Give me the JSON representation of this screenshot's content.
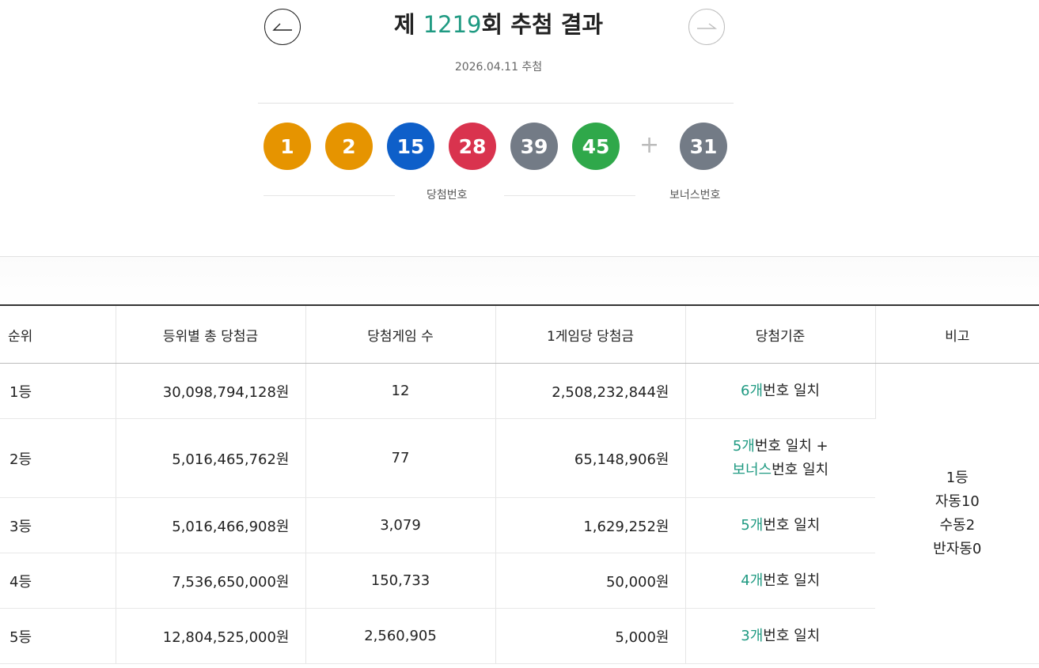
{
  "header": {
    "title_prefix": "제 ",
    "round": "1219",
    "title_suffix": "회 추첨 결과",
    "date": "2026.04.11 추첨"
  },
  "navigation": {
    "prev_icon": "arrow-left-icon",
    "next_icon": "arrow-right-icon"
  },
  "balls": [
    {
      "number": "1",
      "color": "#e69400"
    },
    {
      "number": "2",
      "color": "#e69400"
    },
    {
      "number": "15",
      "color": "#0e5fc9"
    },
    {
      "number": "28",
      "color": "#d9334e"
    },
    {
      "number": "39",
      "color": "#737b86"
    },
    {
      "number": "45",
      "color": "#2fa84a"
    }
  ],
  "plus_sign": "+",
  "bonus_ball": {
    "number": "31",
    "color": "#737b86"
  },
  "labels": {
    "winning": "당첨번호",
    "bonus": "보너스번호"
  },
  "table": {
    "headers": [
      "순위",
      "등위별 총 당첨금",
      "당첨게임 수",
      "1게임당 당첨금",
      "당첨기준",
      "비고"
    ],
    "rows": [
      {
        "rank": "1등",
        "total": "30,098,794,128원",
        "count": "12",
        "each": "2,508,232,844원",
        "crit_a_num": "6개",
        "crit_a_text": "번호 일치",
        "crit_b_num": "",
        "crit_b_text": ""
      },
      {
        "rank": "2등",
        "total": "5,016,465,762원",
        "count": "77",
        "each": "65,148,906원",
        "crit_a_num": "5개",
        "crit_a_text": "번호 일치 +",
        "crit_b_num": "보너스",
        "crit_b_text": "번호 일치"
      },
      {
        "rank": "3등",
        "total": "5,016,466,908원",
        "count": "3,079",
        "each": "1,629,252원",
        "crit_a_num": "5개",
        "crit_a_text": "번호 일치",
        "crit_b_num": "",
        "crit_b_text": ""
      },
      {
        "rank": "4등",
        "total": "7,536,650,000원",
        "count": "150,733",
        "each": "50,000원",
        "crit_a_num": "4개",
        "crit_a_text": "번호 일치",
        "crit_b_num": "",
        "crit_b_text": ""
      },
      {
        "rank": "5등",
        "total": "12,804,525,000원",
        "count": "2,560,905",
        "each": "5,000원",
        "crit_a_num": "3개",
        "crit_a_text": "번호 일치",
        "crit_b_num": "",
        "crit_b_text": ""
      }
    ],
    "note": [
      "1등",
      "자동10",
      "수동2",
      "반자동0"
    ]
  },
  "colors": {
    "accent": "#1f9a82"
  }
}
